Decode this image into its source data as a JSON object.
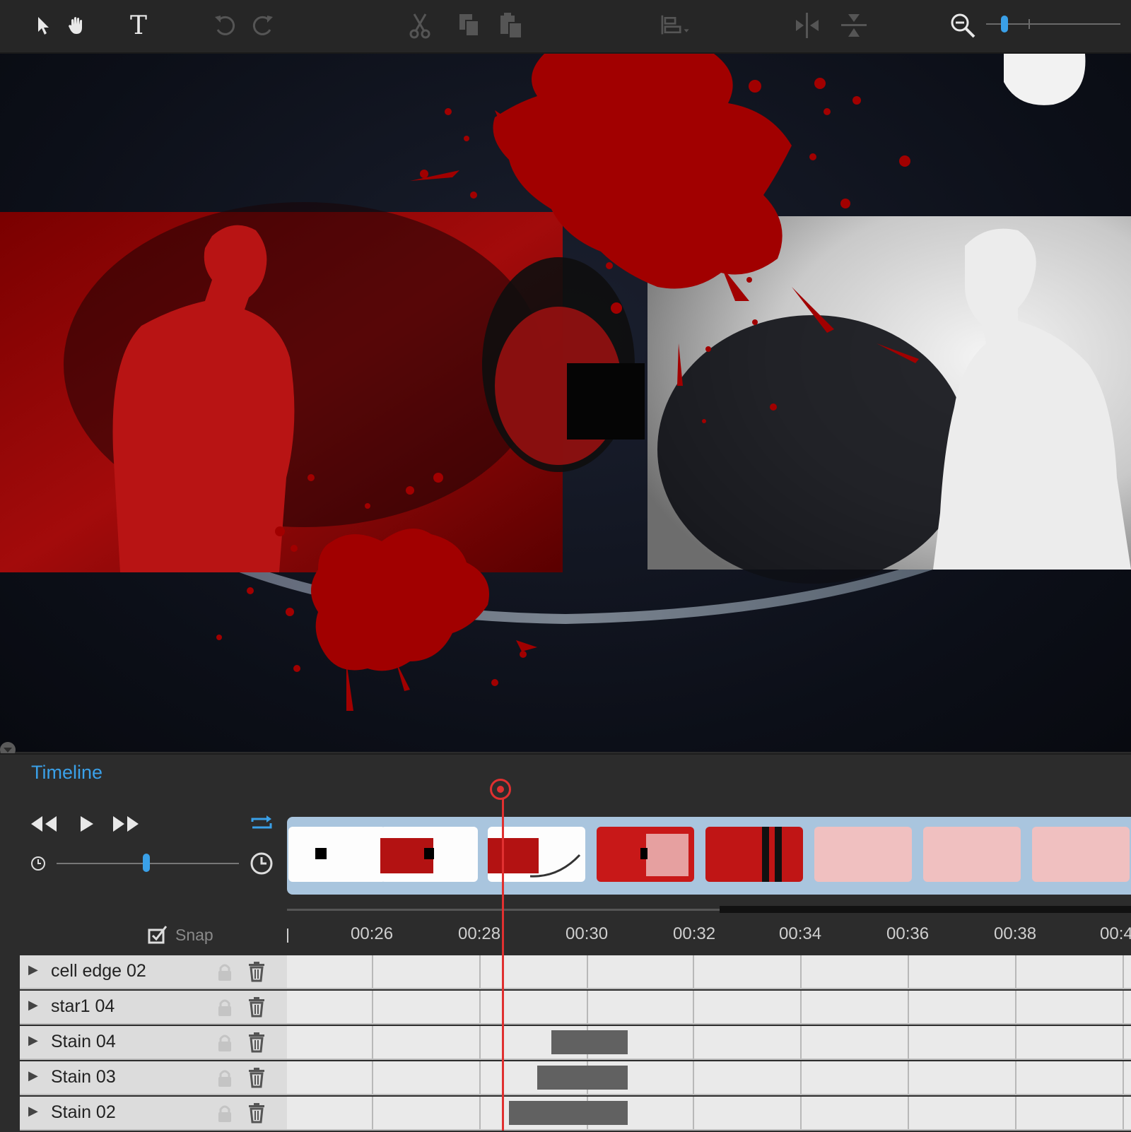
{
  "toolbar": {
    "tools": [
      "select-arrow-icon",
      "hand-icon",
      "text-icon",
      "undo-icon",
      "redo-icon",
      "cut-icon",
      "copy-icon",
      "paste-icon",
      "align-icon",
      "flip-horizontal-icon",
      "flip-vertical-icon",
      "zoom-out-icon"
    ],
    "text_tool_glyph": "T",
    "zoom_level": 0.15
  },
  "timeline": {
    "title": "Timeline",
    "snap_label": "Snap",
    "snap_checked": true,
    "speed_level": 0.5,
    "ruler_labels": [
      "00:26",
      "00:28",
      "00:30",
      "00:32",
      "00:34",
      "00:36",
      "00:38",
      "00:4"
    ],
    "playhead_time": "00:28.4",
    "tracks": [
      {
        "name": "cell edge 02"
      },
      {
        "name": "star1 04"
      },
      {
        "name": "Stain 04"
      },
      {
        "name": "Stain 03"
      },
      {
        "name": "Stain 02"
      }
    ]
  },
  "colors": {
    "accent": "#3aa0e8",
    "playhead": "#e03030",
    "blood": "#a10000"
  }
}
